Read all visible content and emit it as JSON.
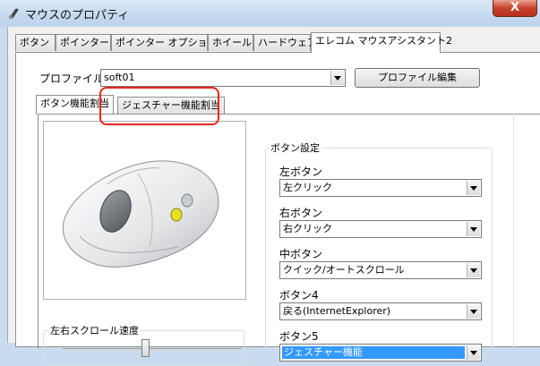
{
  "window": {
    "title": "マウスのプロパティ",
    "close_glyph": "X"
  },
  "tabs": [
    "ボタン",
    "ポインター",
    "ポインター オプション",
    "ホイール",
    "ハードウェア",
    "エレコム マウスアシスタント2"
  ],
  "profile": {
    "label": "プロファイル:",
    "value": "soft01",
    "edit_button": "プロファイル編集"
  },
  "subtabs": [
    "ボタン機能割当",
    "ジェスチャー機能割当"
  ],
  "button_settings": {
    "group_title": "ボタン設定",
    "items": [
      {
        "label": "左ボタン",
        "value": "左クリック"
      },
      {
        "label": "右ボタン",
        "value": "右クリック"
      },
      {
        "label": "中ボタン",
        "value": "クイック/オートスクロール"
      },
      {
        "label": "ボタン4",
        "value": "戻る(InternetExplorer)"
      },
      {
        "label": "ボタン5",
        "value": "ジェスチャー機能"
      }
    ]
  },
  "scroll_speed": {
    "group_title": "左右スクロール速度"
  }
}
